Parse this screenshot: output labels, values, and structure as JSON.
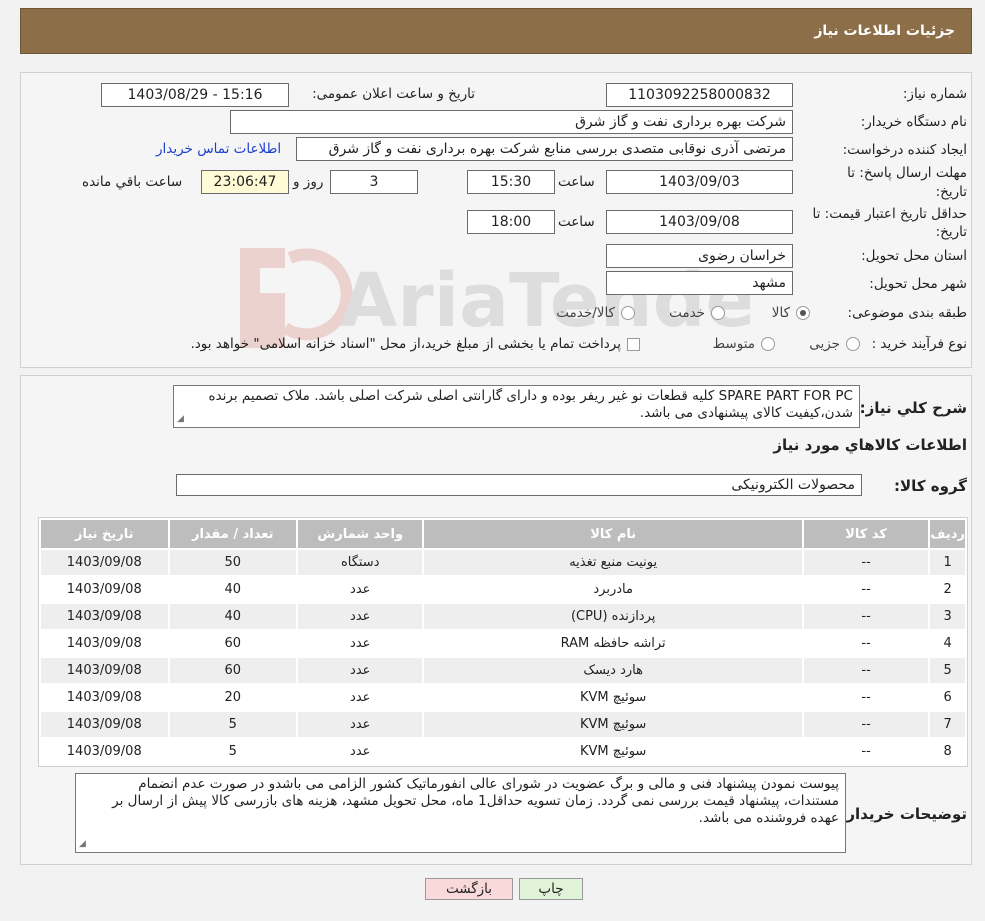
{
  "header": {
    "title": "جزئیات اطلاعات نیاز"
  },
  "form": {
    "need_number_label": "شماره نیاز:",
    "need_number": "1103092258000832",
    "announce_label": "تاریخ و ساعت اعلان عمومی:",
    "announce_value": "1403/08/29 - 15:16",
    "buyer_org_label": "نام دستگاه خریدار:",
    "buyer_org": "شرکت بهره برداری نفت و گاز شرق",
    "creator_label": "ایجاد کننده درخواست:",
    "creator": "مرتضی آذری نوقابی متصدی بررسی منابع شرکت بهره برداری نفت و گاز شرق",
    "contact_link": "اطلاعات تماس خریدار",
    "reply_deadline_label_1": "مهلت ارسال پاسخ: تا",
    "reply_deadline_label_2": "تاریخ:",
    "reply_date": "1403/09/03",
    "time_label": "ساعت",
    "reply_time": "15:30",
    "days": "3",
    "days_label": "روز و",
    "remaining": "23:06:47",
    "remaining_label": "ساعت باقي مانده",
    "validity_label_1": "حداقل تاریخ اعتبار قیمت: تا",
    "validity_label_2": "تاریخ:",
    "validity_date": "1403/09/08",
    "validity_time": "18:00",
    "province_label": "استان محل تحویل:",
    "province": "خراسان رضوی",
    "city_label": "شهر محل تحویل:",
    "city": "مشهد",
    "category_label": "طبقه بندی موضوعی:",
    "category_options": [
      "کالا",
      "خدمت",
      "کالا/خدمت"
    ],
    "category_selected": "کالا",
    "process_label": "نوع فرآیند خرید :",
    "process_options": [
      "جزیی",
      "متوسط"
    ],
    "process_note": "پرداخت تمام یا بخشی از مبلغ خرید،از محل \"اسناد خزانه اسلامی\" خواهد بود."
  },
  "description": {
    "label": "شرح کلي نياز:",
    "text": "SPARE PART FOR PC کلیه قطعات نو غیر ریفر بوده و دارای گارانتی اصلی شرکت اصلی باشد. ملاک تصمیم برنده شدن،کیفیت کالای پیشنهادی می باشد."
  },
  "goods": {
    "section_title": "اطلاعات کالاهاي مورد نياز",
    "group_label": "گروه کالا:",
    "group_value": "محصولات الکترونیکی",
    "columns": [
      "ردیف",
      "کد کالا",
      "نام کالا",
      "واحد شمارش",
      "تعداد / مقدار",
      "تاریخ نیاز"
    ],
    "rows": [
      {
        "row": "1",
        "code": "--",
        "name": "یونیت منبع تغذیه",
        "unit": "دستگاه",
        "qty": "50",
        "date": "1403/09/08"
      },
      {
        "row": "2",
        "code": "--",
        "name": "مادربرد",
        "unit": "عدد",
        "qty": "40",
        "date": "1403/09/08"
      },
      {
        "row": "3",
        "code": "--",
        "name": "پردازنده (CPU)",
        "unit": "عدد",
        "qty": "40",
        "date": "1403/09/08"
      },
      {
        "row": "4",
        "code": "--",
        "name": "تراشه حافظه RAM",
        "unit": "عدد",
        "qty": "60",
        "date": "1403/09/08"
      },
      {
        "row": "5",
        "code": "--",
        "name": "هارد دیسک",
        "unit": "عدد",
        "qty": "60",
        "date": "1403/09/08"
      },
      {
        "row": "6",
        "code": "--",
        "name": "سوئیچ KVM",
        "unit": "عدد",
        "qty": "20",
        "date": "1403/09/08"
      },
      {
        "row": "7",
        "code": "--",
        "name": "سوئیچ KVM",
        "unit": "عدد",
        "qty": "5",
        "date": "1403/09/08"
      },
      {
        "row": "8",
        "code": "--",
        "name": "سوئیچ KVM",
        "unit": "عدد",
        "qty": "5",
        "date": "1403/09/08"
      }
    ]
  },
  "buyer_notes": {
    "label": "توضیحات خریدار:",
    "text": "پیوست نمودن پیشنهاد فنی و مالی و برگ عضویت در شورای عالی انفورماتیک کشور الزامی می باشدو در صورت عدم انضمام مستندات، پیشنهاد قیمت بررسی نمی گردد. زمان تسویه حداقل1 ماه، محل تحویل مشهد، هزینه های بازرسی کالا پیش از ارسال بر عهده فروشنده می باشد."
  },
  "buttons": {
    "print": "چاپ",
    "back": "بازگشت"
  },
  "colors": {
    "header": "#8c6f49",
    "back_button": "#f9d9d9",
    "print_button": "#e0f2d8",
    "remaining_bg": "#fefbd6"
  }
}
